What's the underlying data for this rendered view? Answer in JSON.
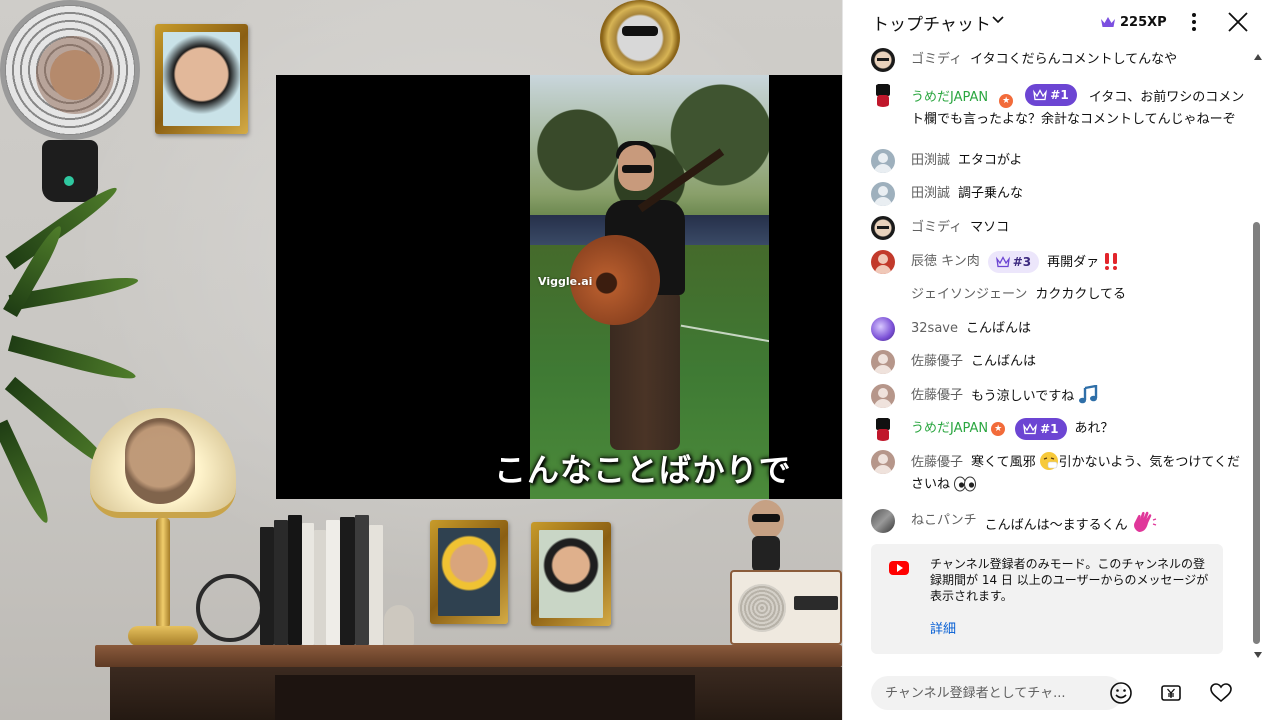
{
  "stream": {
    "watermark": "Viggle.ai",
    "caption": "こんなことばかりで"
  },
  "chat": {
    "header": {
      "title": "トップチャット",
      "xp": "225XP"
    },
    "messages": [
      {
        "author": "ゴミディ",
        "text": "イタコくだらんコメントしてんなや",
        "avatar": "face"
      },
      {
        "author": "うめだJAPAN",
        "rank": "#1",
        "text": "イタコ、お前ワシのコメント欄でも言ったよな？余計なコメントしてんじゃねーぞ",
        "avatar": "hat",
        "member": true
      },
      {
        "author": "田渕誠",
        "text": "エタコがよ",
        "avatar": "person"
      },
      {
        "author": "田渕誠",
        "text": "調子乗んな",
        "avatar": "person"
      },
      {
        "author": "ゴミディ",
        "text": "マソコ",
        "avatar": "face"
      },
      {
        "author": "辰徳 キン肉",
        "rank": "#3",
        "text": "再開ダァ",
        "avatar": "red",
        "emoji": "double-exclamation-icon"
      },
      {
        "author": "ジェイソンジェーン",
        "text": "カクカクしてる",
        "avatar": "blank"
      },
      {
        "author": "32save",
        "text": "こんばんは",
        "avatar": "purple"
      },
      {
        "author": "佐藤優子",
        "text": "こんばんは",
        "avatar": "tan"
      },
      {
        "author": "佐藤優子",
        "text": "もう涼しいですね",
        "avatar": "tan",
        "emoji": "music-note-icon"
      },
      {
        "author": "うめだJAPAN",
        "rank": "#1",
        "text": "あれ？",
        "avatar": "hat",
        "member": true
      },
      {
        "author": "佐藤優子",
        "text_a": "寒くて風邪",
        "text_b": "引かないよう、気をつけてくださいね",
        "avatar": "tan",
        "emoji_mid": "sneezing-face-icon",
        "emoji": "eyes-icon"
      },
      {
        "author": "ねこパンチ",
        "text": "こんばんは～まするくん",
        "avatar": "cat",
        "emoji": "waving-hand-icon"
      }
    ],
    "notice": {
      "text": "チャンネル登録者のみモード。このチャンネルの登録期間が 14 日 以上のユーザーからのメッセージが表示されます。",
      "link": "詳細"
    },
    "input": {
      "placeholder": "チャンネル登録者としてチャ..."
    }
  },
  "colors": {
    "member": "#2ba640",
    "rank_purple": "#6c45d3",
    "link": "#065fd4"
  }
}
